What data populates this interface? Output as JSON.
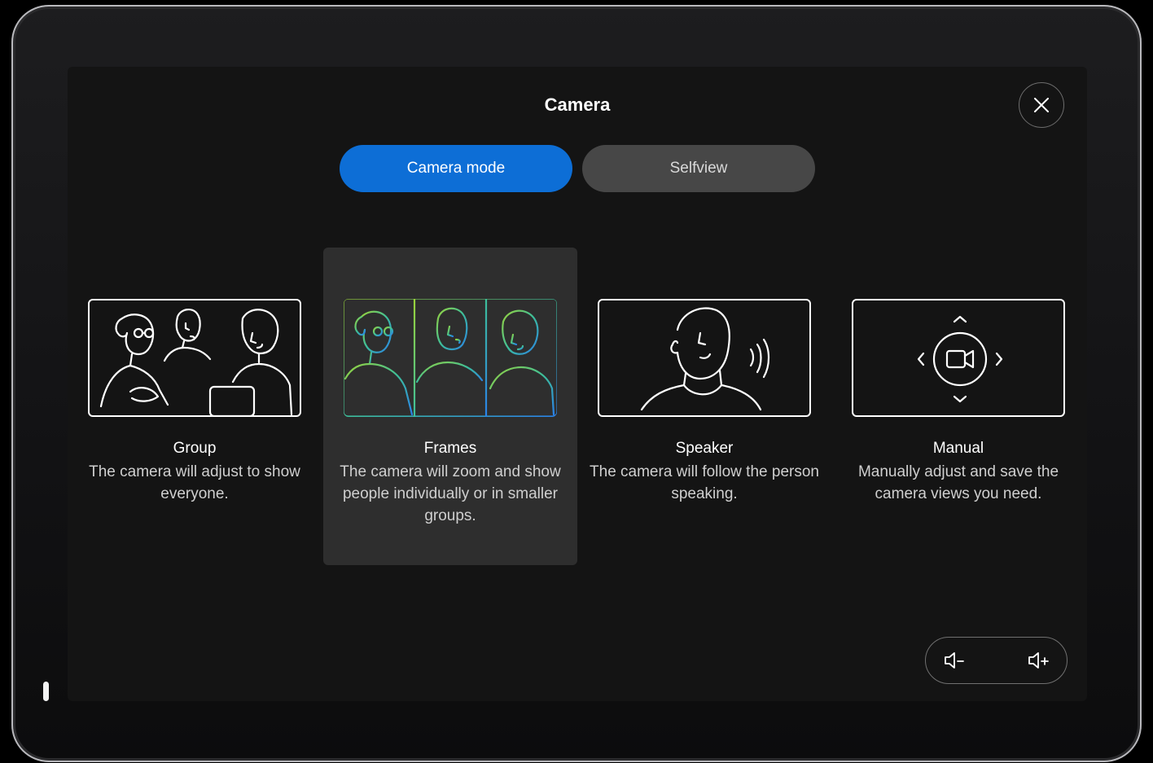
{
  "header": {
    "title": "Camera",
    "close_icon": "close-icon"
  },
  "tabs": [
    {
      "label": "Camera mode",
      "active": true
    },
    {
      "label": "Selfview",
      "active": false
    }
  ],
  "modes": [
    {
      "name": "Group",
      "description": "The camera will adjust to show everyone.",
      "selected": false,
      "icon": "group-illustration-icon"
    },
    {
      "name": "Frames",
      "description": "The camera will zoom and show people individually or in smaller groups.",
      "selected": true,
      "icon": "frames-illustration-icon"
    },
    {
      "name": "Speaker",
      "description": "The camera will follow the person speaking.",
      "selected": false,
      "icon": "speaker-illustration-icon"
    },
    {
      "name": "Manual",
      "description": "Manually adjust and save the camera views you need.",
      "selected": false,
      "icon": "manual-illustration-icon"
    }
  ],
  "volume": {
    "down_icon": "volume-down-icon",
    "up_icon": "volume-up-icon"
  },
  "colors": {
    "accent": "#0d6ed6",
    "tab_inactive": "#474747",
    "selected_card": "#2e2e2e",
    "background": "#141414",
    "frames_gradient_start": "#8fcf3a",
    "frames_gradient_end": "#2a8fe8"
  }
}
